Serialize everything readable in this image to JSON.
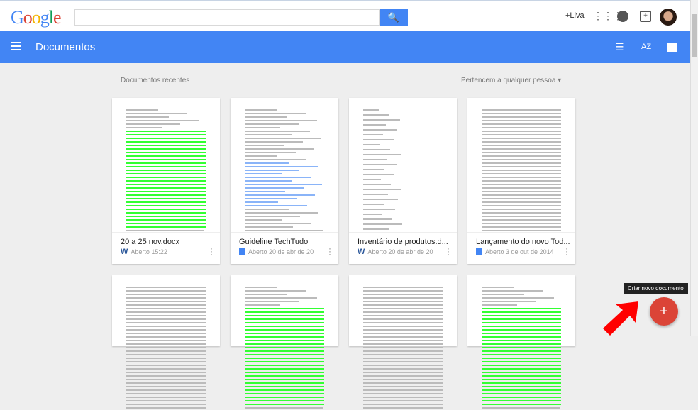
{
  "header": {
    "logo": "Google",
    "search_placeholder": "",
    "search_icon": "search-icon",
    "user_link": "+Liva"
  },
  "toolbar": {
    "title": "Documentos",
    "icons": [
      "list-view-icon",
      "sort-az-icon",
      "folder-icon"
    ],
    "sort_label": "AZ"
  },
  "main": {
    "section_title": "Documentos recentes",
    "filter_label": "Pertencem a qualquer pessoa",
    "documents": [
      {
        "name": "20 a 25 nov.docx",
        "meta": "Aberto 15:22",
        "type": "word",
        "style": "green"
      },
      {
        "name": "Guideline TechTudo",
        "meta": "Aberto 20 de abr de 20",
        "type": "gdoc",
        "style": "links"
      },
      {
        "name": "Inventário de produtos.d...",
        "meta": "Aberto 20 de abr de 20",
        "type": "word",
        "style": "list"
      },
      {
        "name": "Lançamento do novo Tod...",
        "meta": "Aberto 3 de out de 2014",
        "type": "gdoc",
        "style": "text"
      }
    ]
  },
  "fab": {
    "label": "+",
    "tooltip": "Criar novo documento"
  }
}
